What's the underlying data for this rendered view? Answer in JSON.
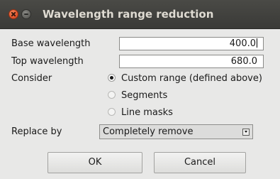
{
  "window": {
    "title": "Wavelength range reduction"
  },
  "form": {
    "base": {
      "label": "Base wavelength",
      "value": "400.0"
    },
    "top": {
      "label": "Top wavelength",
      "value": "680.0"
    },
    "consider": {
      "label": "Consider",
      "options": [
        "Custom range (defined above)",
        "Segments",
        "Line masks"
      ],
      "selected": "Custom range (defined above)"
    },
    "replace": {
      "label": "Replace by",
      "selected": "Completely remove"
    }
  },
  "buttons": {
    "ok": "OK",
    "cancel": "Cancel"
  }
}
